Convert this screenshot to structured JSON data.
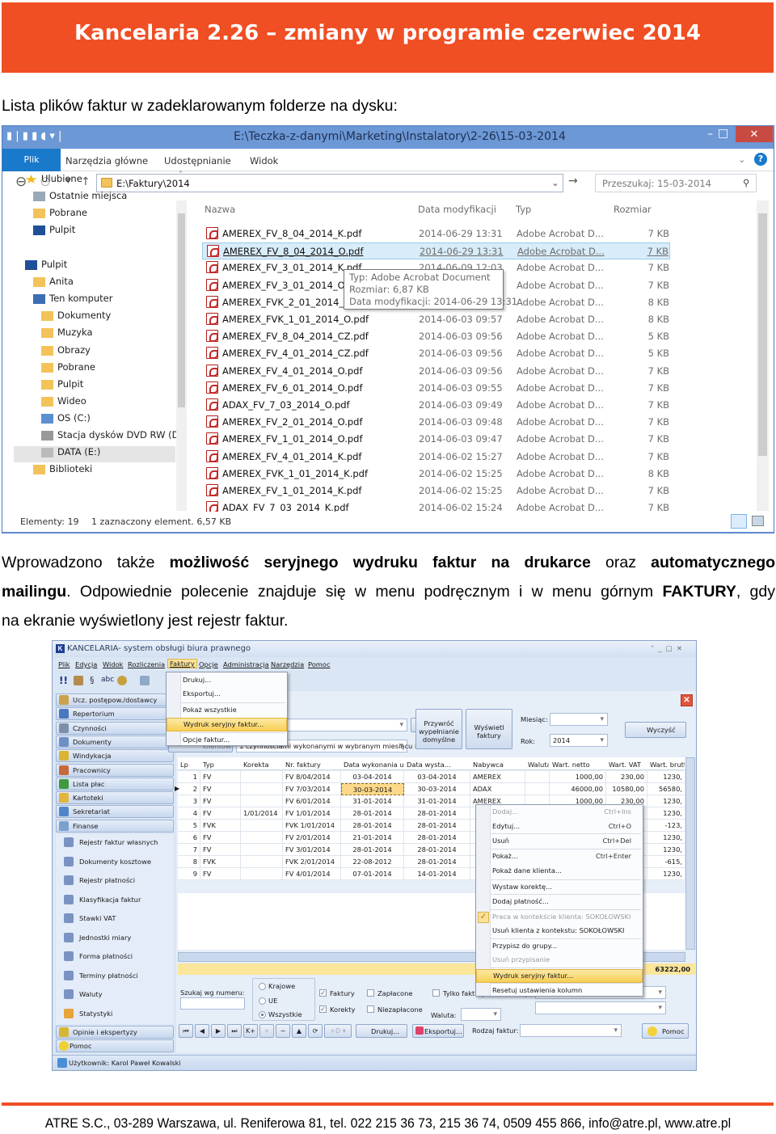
{
  "header": {
    "title": "Kancelaria 2.26 – zmiany w programie czerwiec 2014",
    "color": "#f04e23"
  },
  "intro": "Lista plików faktur w zadeklarowanym folderze na dysku:",
  "explorer": {
    "title": "E:\\Teczka-z-danymi\\Marketing\\Instalatory\\2-26\\15-03-2014",
    "ribbon_tabs": [
      "Plik",
      "Narzędzia główne",
      "Udostępnianie",
      "Widok"
    ],
    "address": "E:\\Faktury\\2014",
    "search_placeholder": "Przeszukaj: 15-03-2014",
    "nav": [
      "Ulubione",
      "Ostatnie miejsca",
      "Pobrane",
      "Pulpit",
      "Pulpit",
      "Anita",
      "Ten komputer",
      "Dokumenty",
      "Muzyka",
      "Obrazy",
      "Pobrane",
      "Pulpit",
      "Wideo",
      "OS (C:)",
      "Stacja dysków DVD RW (D:)",
      "DATA (E:)",
      "Biblioteki"
    ],
    "columns": [
      "Nazwa",
      "Data modyfikacji",
      "Typ",
      "Rozmiar"
    ],
    "files": [
      {
        "name": "AMEREX_FV_8_04_2014_K.pdf",
        "date": "2014-06-29 13:31",
        "type": "Adobe Acrobat D...",
        "size": "7 KB"
      },
      {
        "name": "AMEREX_FV_8_04_2014_O.pdf",
        "date": "2014-06-29 13:31",
        "type": "Adobe Acrobat D...",
        "size": "7 KB",
        "selected": true
      },
      {
        "name": "AMEREX_FV_3_01_2014_K.pdf",
        "date": "2014-06-09 12:03",
        "type": "Adobe Acrobat D...",
        "size": "7 KB"
      },
      {
        "name": "AMEREX_FV_3_01_2014_O.pdf",
        "date": "",
        "type": "Adobe Acrobat D...",
        "size": "7 KB"
      },
      {
        "name": "AMEREX_FVK_2_01_2014_O.pdf",
        "date": "",
        "type": "Adobe Acrobat D...",
        "size": "8 KB"
      },
      {
        "name": "AMEREX_FVK_1_01_2014_O.pdf",
        "date": "2014-06-03 09:57",
        "type": "Adobe Acrobat D...",
        "size": "8 KB"
      },
      {
        "name": "AMEREX_FV_8_04_2014_CZ.pdf",
        "date": "2014-06-03 09:56",
        "type": "Adobe Acrobat D...",
        "size": "5 KB"
      },
      {
        "name": "AMEREX_FV_4_01_2014_CZ.pdf",
        "date": "2014-06-03 09:56",
        "type": "Adobe Acrobat D...",
        "size": "5 KB"
      },
      {
        "name": "AMEREX_FV_4_01_2014_O.pdf",
        "date": "2014-06-03 09:56",
        "type": "Adobe Acrobat D...",
        "size": "7 KB"
      },
      {
        "name": "AMEREX_FV_6_01_2014_O.pdf",
        "date": "2014-06-03 09:55",
        "type": "Adobe Acrobat D...",
        "size": "7 KB"
      },
      {
        "name": "ADAX_FV_7_03_2014_O.pdf",
        "date": "2014-06-03 09:49",
        "type": "Adobe Acrobat D...",
        "size": "7 KB"
      },
      {
        "name": "AMEREX_FV_2_01_2014_O.pdf",
        "date": "2014-06-03 09:48",
        "type": "Adobe Acrobat D...",
        "size": "7 KB"
      },
      {
        "name": "AMEREX_FV_1_01_2014_O.pdf",
        "date": "2014-06-03 09:47",
        "type": "Adobe Acrobat D...",
        "size": "7 KB"
      },
      {
        "name": "AMEREX_FV_4_01_2014_K.pdf",
        "date": "2014-06-02 15:27",
        "type": "Adobe Acrobat D...",
        "size": "7 KB"
      },
      {
        "name": "AMEREX_FVK_1_01_2014_K.pdf",
        "date": "2014-06-02 15:25",
        "type": "Adobe Acrobat D...",
        "size": "8 KB"
      },
      {
        "name": "AMEREX_FV_1_01_2014_K.pdf",
        "date": "2014-06-02 15:25",
        "type": "Adobe Acrobat D...",
        "size": "7 KB"
      },
      {
        "name": "ADAX_FV_7_03_2014_K.pdf",
        "date": "2014-06-02 15:24",
        "type": "Adobe Acrobat D...",
        "size": "7 KB"
      }
    ],
    "tooltip": [
      "Typ: Adobe Acrobat Document",
      "Rozmiar: 6,87 KB",
      "Data modyfikacji: 2014-06-29 13:31"
    ],
    "status_count": "Elementy: 19",
    "status_selected": "1 zaznaczony element. 6,57 KB"
  },
  "paragraph": {
    "line1": [
      {
        "t": "Wprowadzono",
        "b": false
      },
      {
        "t": "także",
        "b": false
      },
      {
        "t": "możliwość",
        "b": true
      },
      {
        "t": "seryjnego",
        "b": true
      },
      {
        "t": "wydruku",
        "b": true
      },
      {
        "t": "faktur",
        "b": true
      },
      {
        "t": "na",
        "b": true
      },
      {
        "t": "drukarce",
        "b": true
      },
      {
        "t": "oraz",
        "b": false
      },
      {
        "t": "automatycznego",
        "b": true
      }
    ],
    "line2_bold": "mailingu",
    "line2": ". Odpowiednie polecenie znajduje się w menu podręcznym i w menu górnym ",
    "line2_bold2": "FAKTURY",
    "line2_end": ", gdy",
    "line3": "na ekranie wyświetlony jest rejestr faktur."
  },
  "kancelaria": {
    "title": "KANCELARIA- system obsługi biura prawnego",
    "menu": [
      "Plik",
      "Edycja",
      "Widok",
      "Rozliczenia",
      "Faktury",
      "Opcje",
      "Administracja",
      "Narzędzia",
      "Pomoc"
    ],
    "faktury_menu": [
      "Drukuj...",
      "Eksportuj...",
      "Pokaż wszystkie",
      "Wydruk seryjny faktur...",
      "Opcje faktur..."
    ],
    "nav_top": [
      "Ucz. postępow./dostawcy",
      "Repertorium",
      "Czynności",
      "Dokumenty",
      "Windykacja",
      "Pracownicy",
      "Lista płac",
      "Kartoteki",
      "Sekretariat",
      "Finanse"
    ],
    "nav_sub": [
      "Rejestr faktur własnych",
      "Dokumenty kosztowe",
      "Rejestr płatności",
      "Klasyfikacja faktur",
      "Stawki VAT",
      "Jednostki miary",
      "Forma płatności",
      "Terminy płatności",
      "Waluty",
      "Statystyki"
    ],
    "nav_bottom": [
      "Opinie i ekspertyzy",
      "Pomoc"
    ],
    "user": "Użytkownik: Karol Paweł Kowalski",
    "filter": {
      "clients_btn": "klientów",
      "activity_combo": "z czynnościami wykonanymi w wybranym miesiącu i",
      "restore_btn": "Przywróć wypełnianie domyślne",
      "show_btn": "Wyświetl faktury",
      "month_label": "Miesiąc:",
      "month": "",
      "year_label": "Rok:",
      "year": "2014",
      "clear_btn": "Wyczyść"
    },
    "columns": [
      "Lp",
      "Typ",
      "Korekta",
      "Nr. faktury",
      "Data wykonania usługi",
      "Data wysta...",
      "Nabywca",
      "Waluta",
      "Wart. netto",
      "Wart. VAT",
      "Wart. brutto"
    ],
    "rows": [
      [
        "1",
        "FV",
        "",
        "FV 8/04/2014",
        "03-04-2014",
        "03-04-2014",
        "AMEREX",
        "",
        "1000,00",
        "230,00",
        "1230,"
      ],
      [
        "2",
        "FV",
        "",
        "FV 7/03/2014",
        "30-03-2014",
        "30-03-2014",
        "ADAX",
        "",
        "46000,00",
        "10580,00",
        "56580,"
      ],
      [
        "3",
        "FV",
        "",
        "FV 6/01/2014",
        "31-01-2014",
        "31-01-2014",
        "AMEREX",
        "",
        "1000,00",
        "230,00",
        "1230,"
      ],
      [
        "4",
        "FV",
        "1/01/2014",
        "FV 1/01/2014",
        "28-01-2014",
        "28-01-2014",
        "",
        "",
        "",
        "",
        "1230,"
      ],
      [
        "5",
        "FVK",
        "",
        "FVK 1/01/2014",
        "28-01-2014",
        "28-01-2014",
        "",
        "",
        "",
        "",
        "-123,"
      ],
      [
        "6",
        "FV",
        "",
        "FV 2/01/2014",
        "21-01-2014",
        "28-01-2014",
        "",
        "",
        "",
        "",
        "1230,"
      ],
      [
        "7",
        "FV",
        "",
        "FV 3/01/2014",
        "28-01-2014",
        "28-01-2014",
        "",
        "",
        "",
        "",
        "1230,"
      ],
      [
        "8",
        "FVK",
        "",
        "FVK 2/01/2014",
        "22-08-2012",
        "28-01-2014",
        "",
        "",
        "",
        "",
        "-615,"
      ],
      [
        "9",
        "FV",
        "",
        "FV 4/01/2014",
        "07-01-2014",
        "14-01-2014",
        "",
        "",
        "",
        "",
        "1230,"
      ]
    ],
    "total": "63222,00",
    "context_menu": [
      {
        "label": "Dodaj...",
        "shortcut": "Ctrl+Ins",
        "disabled": true
      },
      {
        "label": "Edytuj...",
        "shortcut": "Ctrl+O"
      },
      {
        "label": "Usuń",
        "shortcut": "Ctrl+Del"
      },
      {
        "label": "Pokaż...",
        "shortcut": "Ctrl+Enter"
      },
      {
        "label": "Pokaż dane klienta..."
      },
      {
        "label": "Wystaw korektę..."
      },
      {
        "label": "Dodaj płatność..."
      },
      {
        "label": "Praca w kontekście klienta: SOKOŁOWSKI",
        "disabled": true,
        "checked": true
      },
      {
        "label": "Usuń klienta z kontekstu: SOKOŁOWSKI"
      },
      {
        "label": "Przypisz do grupy..."
      },
      {
        "label": "Usuń przypisanie",
        "disabled": true
      },
      {
        "label": "Wydruk seryjny faktur...",
        "highlight": true
      },
      {
        "label": "Resetuj ustawienia kolumn"
      }
    ],
    "bottom": {
      "search_label": "Szukaj wg numeru:",
      "search_value": "",
      "radios": [
        "Krajowe",
        "UE",
        "Wszystkie"
      ],
      "radio_selected": "Wszystkie",
      "checks": [
        {
          "label": "Faktury",
          "checked": true
        },
        {
          "label": "Korekty",
          "checked": true
        },
        {
          "label": "Zapłacone",
          "checked": false
        },
        {
          "label": "Niezapłacone",
          "checked": false
        },
        {
          "label": "Tylko faktury i ich korekty",
          "checked": false
        }
      ],
      "currency_label": "Waluta:",
      "print_btn": "Drukuj...",
      "export_btn": "Eksportuj...",
      "kind_label": "Rodzaj faktur:",
      "help_btn": "Pomoc"
    }
  },
  "footer": "ATRE S.C., 03-289 Warszawa, ul. Reniferowa 81, tel. 022 215 36 73, 215 36 74, 0509 455 866, info@atre.pl, www.atre.pl"
}
